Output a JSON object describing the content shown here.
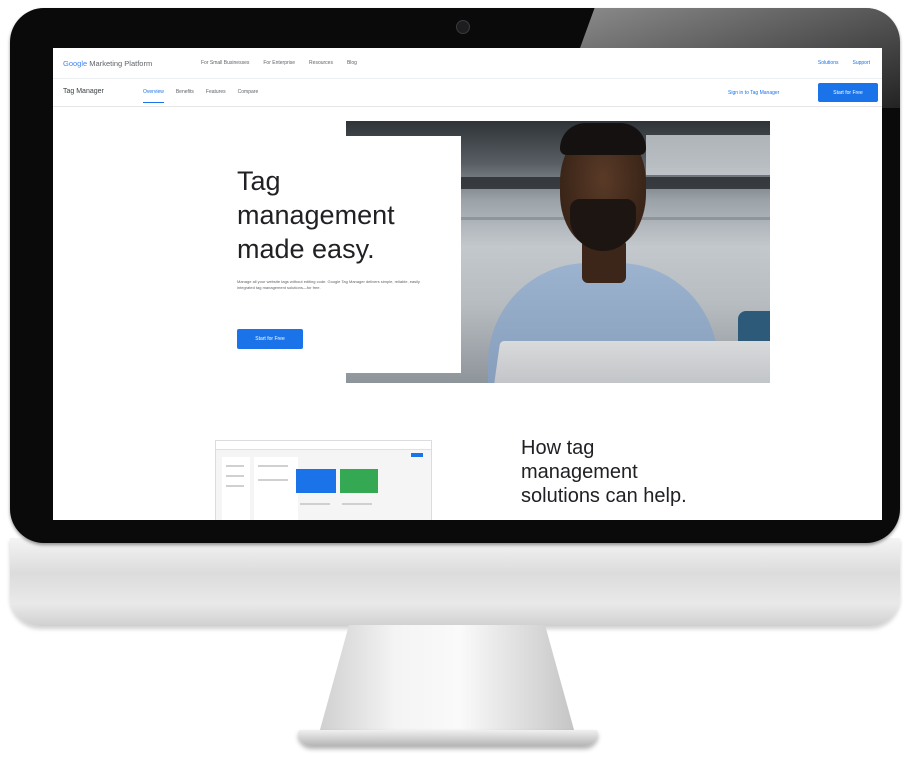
{
  "gmp_bar": {
    "logo_google": "Google",
    "logo_rest": " Marketing Platform",
    "nav": [
      "For Small Businesses",
      "For Enterprise",
      "Resources",
      "Blog"
    ],
    "right_links": [
      "Solutions",
      "Support"
    ]
  },
  "product_bar": {
    "name": "Tag Manager",
    "tabs": [
      "Overview",
      "Benefits",
      "Features",
      "Compare"
    ],
    "active_tab": "Overview",
    "sign_in": "Sign in to Tag Manager",
    "start_button": "Start for Free"
  },
  "hero": {
    "title": "Tag\nmanagement\nmade easy.",
    "description": "Manage all your website tags without editing code. Google Tag Manager delivers simple, reliable, easily integrated tag management solutions—for free.",
    "button": "Start for Free"
  },
  "section2": {
    "title": "How tag\nmanagement\nsolutions can help."
  },
  "colors": {
    "accent": "#1a73e8",
    "green": "#34a853",
    "bezel": "#0a0a0b"
  }
}
